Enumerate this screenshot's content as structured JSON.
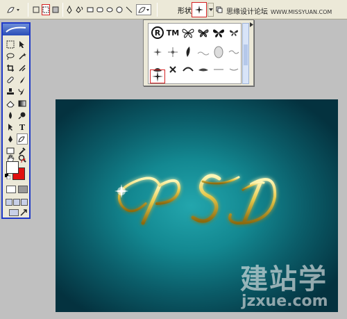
{
  "options_bar": {
    "shape_label": "形状:",
    "site_name": "思缘设计论坛",
    "site_url": "WWW.MISSYUAN.COM"
  },
  "shapes_popup": {
    "row1": [
      "®",
      "TM",
      "butterfly",
      "butterfly",
      "butterfly",
      "butterfly"
    ],
    "row2": [
      "splat",
      "splat",
      "feather",
      "oval-frame",
      "scroll",
      "ornament"
    ],
    "row3": [
      "sparkle",
      "mark",
      "mark",
      "mark",
      "ornament",
      "ornament"
    ],
    "selected": "sparkle"
  },
  "toolbox": {
    "logo": "ps"
  },
  "colors": {
    "foreground": "#ffffff",
    "background": "#e01010",
    "selection_border": "#d42020",
    "toolbox_border": "#1f39c8"
  },
  "canvas": {
    "text": "PSD"
  },
  "watermark": {
    "big": "建站学",
    "small": "jzxue.com"
  }
}
